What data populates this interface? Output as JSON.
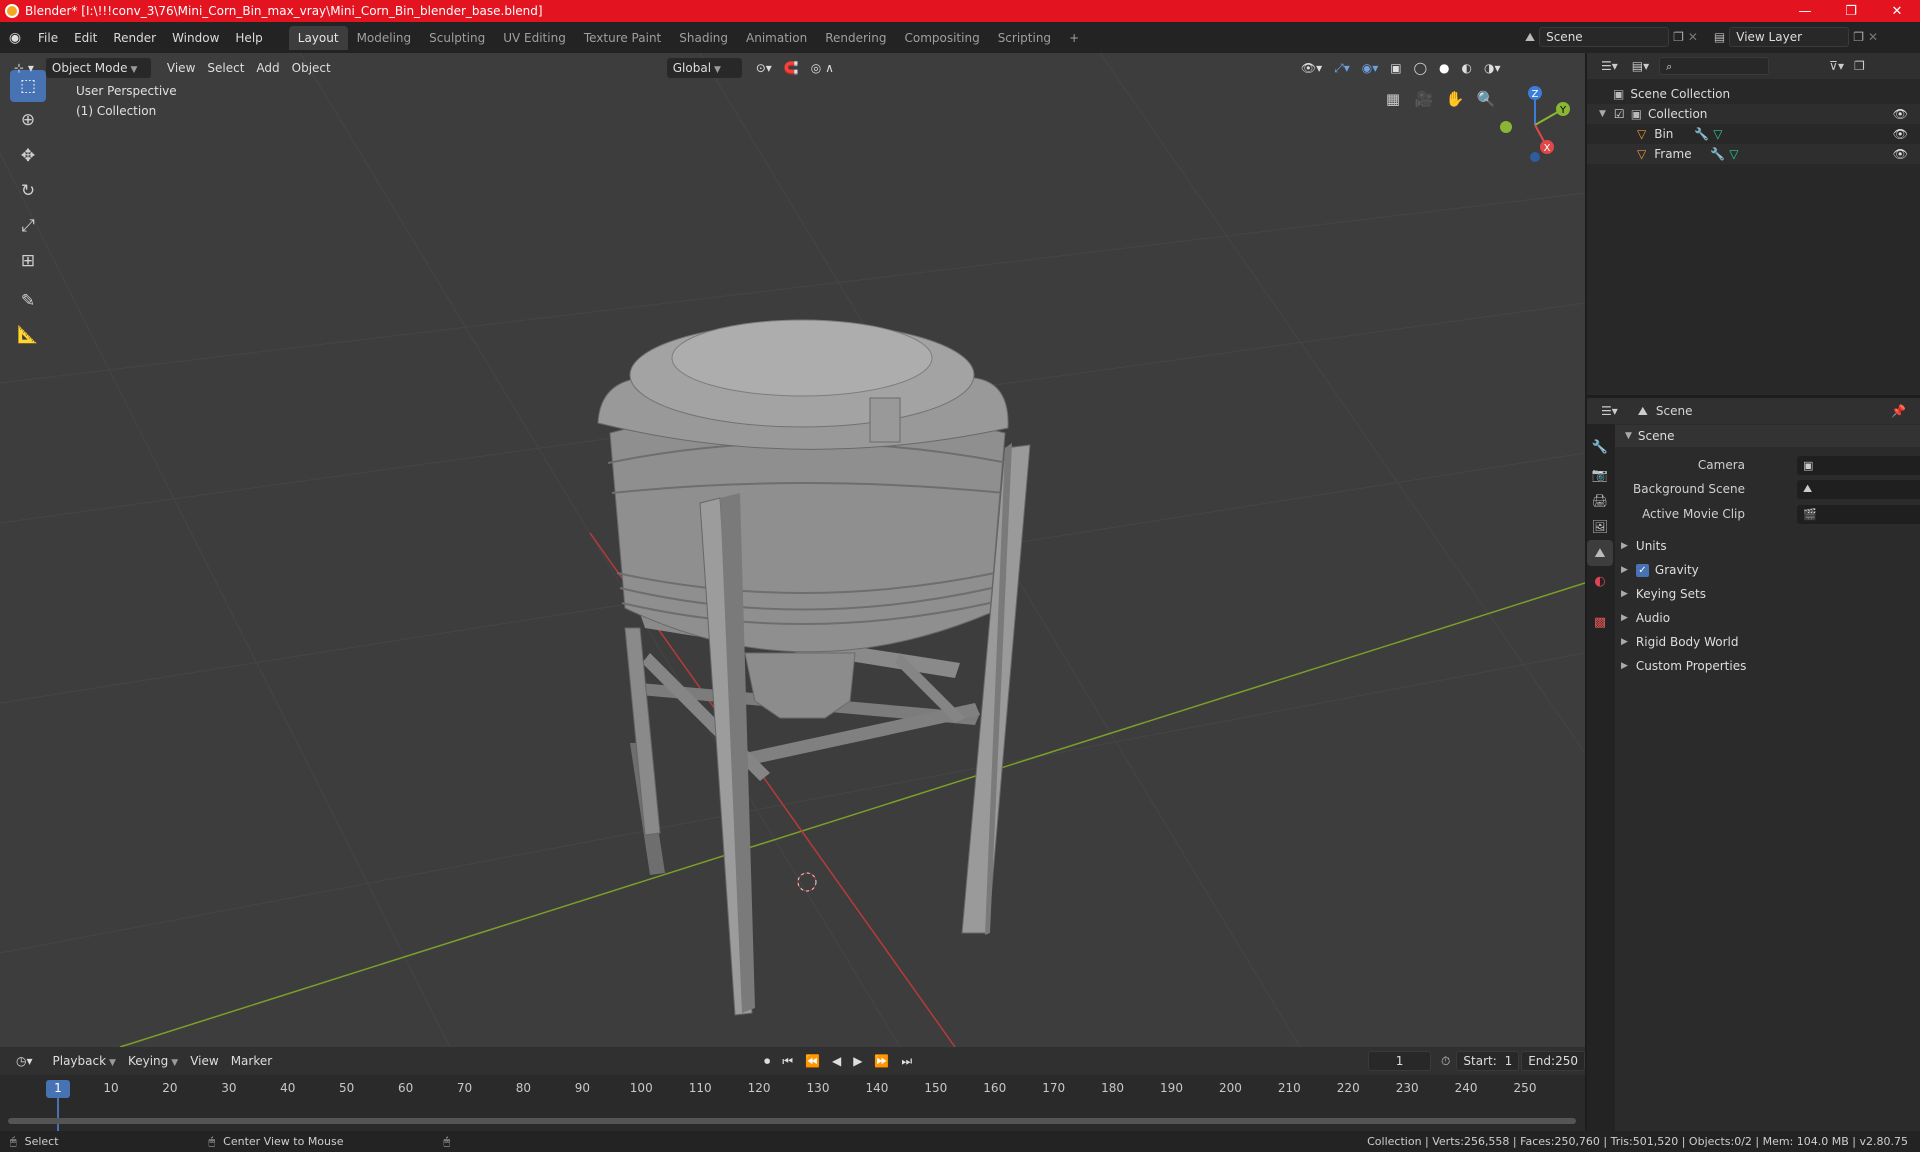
{
  "window": {
    "title": "Blender* [I:\\!!!conv_3\\76\\Mini_Corn_Bin_max_vray\\Mini_Corn_Bin_blender_base.blend]",
    "controls": [
      "—",
      "❐",
      "✕"
    ]
  },
  "menubar": {
    "menus": [
      "File",
      "Edit",
      "Render",
      "Window",
      "Help"
    ],
    "workspaces": [
      "Layout",
      "Modeling",
      "Sculpting",
      "UV Editing",
      "Texture Paint",
      "Shading",
      "Animation",
      "Rendering",
      "Compositing",
      "Scripting"
    ],
    "active_workspace": "Layout",
    "add_tab": "+",
    "scene": "Scene",
    "view_layer": "View Layer"
  },
  "viewport": {
    "mode": "Object Mode",
    "menus": [
      "View",
      "Select",
      "Add",
      "Object"
    ],
    "transform_orientation": "Global",
    "info_line1": "User Perspective",
    "info_line2": "(1) Collection",
    "gizmo": {
      "z": "Z",
      "y": "Y",
      "x": "X"
    },
    "colors": {
      "bg": "#3d3d3d",
      "x_axis": "#b83a3a",
      "y_axis": "#7aa02a",
      "active": "#4772b3"
    }
  },
  "outliner": {
    "search_placeholder": "",
    "root": "Scene Collection",
    "collection": "Collection",
    "objects": [
      "Bin",
      "Frame"
    ]
  },
  "properties": {
    "context": "Scene",
    "panel_title": "Scene",
    "fields": [
      {
        "label": "Camera",
        "value": ""
      },
      {
        "label": "Background Scene",
        "value": ""
      },
      {
        "label": "Active Movie Clip",
        "value": ""
      }
    ],
    "sections": [
      "Units",
      "Gravity",
      "Keying Sets",
      "Audio",
      "Rigid Body World",
      "Custom Properties"
    ],
    "gravity_checked": true
  },
  "timeline": {
    "menus": [
      "Playback",
      "Keying",
      "View",
      "Marker"
    ],
    "current_frame": "1",
    "start_label": "Start:",
    "start": "1",
    "end_label": "End:",
    "end": "250",
    "ticks": [
      "1",
      "10",
      "20",
      "30",
      "40",
      "50",
      "60",
      "70",
      "80",
      "90",
      "100",
      "110",
      "120",
      "130",
      "140",
      "150",
      "160",
      "170",
      "180",
      "190",
      "200",
      "210",
      "220",
      "230",
      "240",
      "250"
    ]
  },
  "statusbar": {
    "select": "Select",
    "center_view": "Center View to Mouse",
    "stats": "Collection | Verts:256,558 | Faces:250,760 | Tris:501,520 | Objects:0/2 | Mem: 104.0 MB | v2.80.75"
  }
}
